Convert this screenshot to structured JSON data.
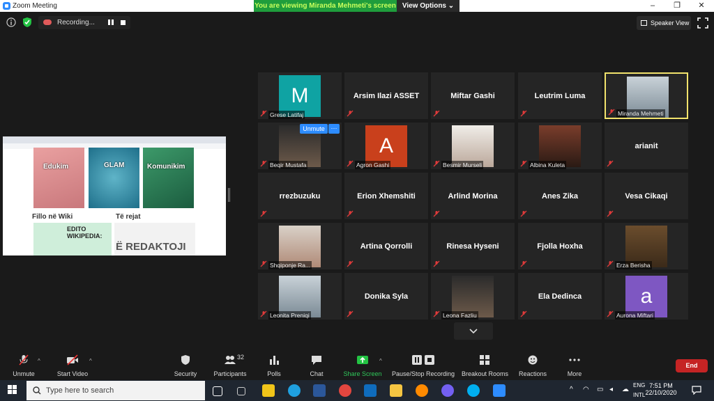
{
  "window": {
    "title": "Zoom Meeting",
    "minimize": "–",
    "maximize": "❐",
    "close": "✕"
  },
  "banner": {
    "viewing": "You are viewing Miranda Mehmeti's screen",
    "view_options": "View Options ⌄"
  },
  "recording": {
    "label": "Recording..."
  },
  "speaker_view": "Speaker View",
  "shared_screen": {
    "tiles": [
      "Edukim",
      "GLAM",
      "Komunikim"
    ],
    "headings": [
      "Fillo në Wiki",
      "Të rejat"
    ],
    "edito": "EDITO WIKIPEDIA:",
    "redaktoji": "Ë REDAKTOJI"
  },
  "participants": [
    {
      "name": "Grese Latifaj",
      "letter": "M",
      "color": "#0fa3a3",
      "type": "letter"
    },
    {
      "name": "Arsim Ilazi ASSET",
      "type": "name"
    },
    {
      "name": "Miftar Gashi",
      "type": "name"
    },
    {
      "name": "Leutrim Luma",
      "type": "name"
    },
    {
      "name": "Miranda Mehmeti",
      "type": "photo",
      "active": true
    },
    {
      "name": "Beqir Mustafa",
      "type": "photo"
    },
    {
      "name": "Agron Gashi",
      "letter": "A",
      "color": "#c9401c",
      "type": "letter"
    },
    {
      "name": "Besmir Murseli",
      "type": "photo"
    },
    {
      "name": "Albina Kuleta",
      "type": "photo"
    },
    {
      "name": "arianit",
      "type": "name"
    },
    {
      "name": "rrezbuzuku",
      "type": "name"
    },
    {
      "name": "Erion Xhemshiti",
      "type": "name"
    },
    {
      "name": "Arlind Morina",
      "type": "name"
    },
    {
      "name": "Anes Zika",
      "type": "name"
    },
    {
      "name": "Vesa Cikaqi",
      "type": "name"
    },
    {
      "name": "Shqiponje Ra...",
      "type": "photo"
    },
    {
      "name": "Artina Qorrolli",
      "type": "name"
    },
    {
      "name": "Rinesa Hyseni",
      "type": "name"
    },
    {
      "name": "Fjolla Hoxha",
      "type": "name"
    },
    {
      "name": "Erza Berisha",
      "type": "photo"
    },
    {
      "name": "Leonita Preniqi",
      "type": "photo"
    },
    {
      "name": "Donika Syla",
      "type": "name"
    },
    {
      "name": "Leona Fazliu",
      "type": "photo"
    },
    {
      "name": "Ela Dedinca",
      "type": "name"
    },
    {
      "name": "Aurona Miftari",
      "letter": "a",
      "color": "#7e57c2",
      "type": "letter"
    }
  ],
  "hover": {
    "unmute": "Unmute",
    "more": "···"
  },
  "toolbar": {
    "unmute": "Unmute",
    "start_video": "Start Video",
    "security": "Security",
    "participants": "Participants",
    "participants_count": "32",
    "polls": "Polls",
    "chat": "Chat",
    "share_screen": "Share Screen",
    "pause_stop": "Pause/Stop Recording",
    "breakout": "Breakout Rooms",
    "reactions": "Reactions",
    "more": "More",
    "end": "End"
  },
  "taskbar": {
    "search_placeholder": "Type here to search",
    "lang1": "ENG",
    "lang2": "INTL",
    "time": "7:51 PM",
    "date": "22/10/2020"
  },
  "colors": {
    "zoom_blue": "#2d8cff",
    "green": "#1f9d3c",
    "end_red": "#c52424",
    "active_border": "#f2e36c"
  }
}
